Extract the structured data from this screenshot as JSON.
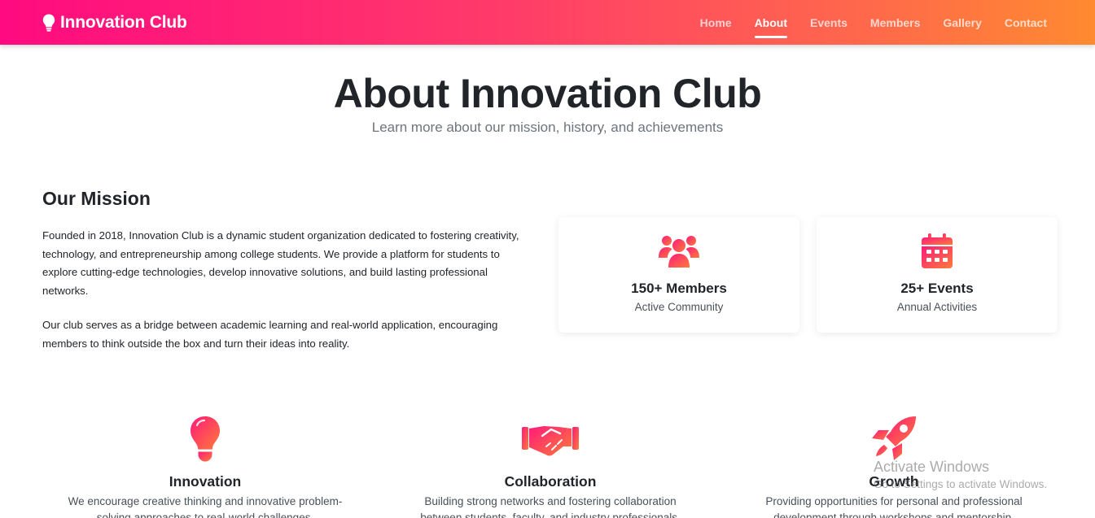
{
  "colors": {
    "gradient_start": "#ff0a80",
    "gradient_end": "#ff8a30",
    "text_dark": "#212529",
    "text_muted": "#6c757d"
  },
  "navbar": {
    "brand_icon": "lightbulb-icon",
    "brand": "Innovation Club",
    "links": [
      {
        "label": "Home"
      },
      {
        "label": "About",
        "active": true
      },
      {
        "label": "Events"
      },
      {
        "label": "Members"
      },
      {
        "label": "Gallery"
      },
      {
        "label": "Contact"
      }
    ]
  },
  "hero": {
    "title": "About Innovation Club",
    "subtitle": "Learn more about our mission, history, and achievements"
  },
  "mission": {
    "title": "Our Mission",
    "paragraphs": [
      "Founded in 2018, Innovation Club is a dynamic student organization dedicated to fostering creativity, technology, and entrepreneurship among college students. We provide a platform for students to explore cutting-edge technologies, develop innovative solutions, and build lasting professional networks.",
      "Our club serves as a bridge between academic learning and real-world application, encouraging members to think outside the box and turn their ideas into reality."
    ]
  },
  "stats": [
    {
      "icon": "users-icon",
      "value": "150+ Members",
      "label": "Active Community"
    },
    {
      "icon": "calendar-icon",
      "value": "25+ Events",
      "label": "Annual Activities"
    }
  ],
  "values": [
    {
      "icon": "lightbulb-icon",
      "title": "Innovation",
      "text": "We encourage creative thinking and innovative problem-solving approaches to real-world challenges."
    },
    {
      "icon": "handshake-icon",
      "title": "Collaboration",
      "text": "Building strong networks and fostering collaboration between students, faculty, and industry professionals."
    },
    {
      "icon": "rocket-icon",
      "title": "Growth",
      "text": "Providing opportunities for personal and professional development through workshops and mentorship."
    }
  ],
  "watermark": {
    "title": "Activate Windows",
    "subtitle": "Go to Settings to activate Windows."
  }
}
